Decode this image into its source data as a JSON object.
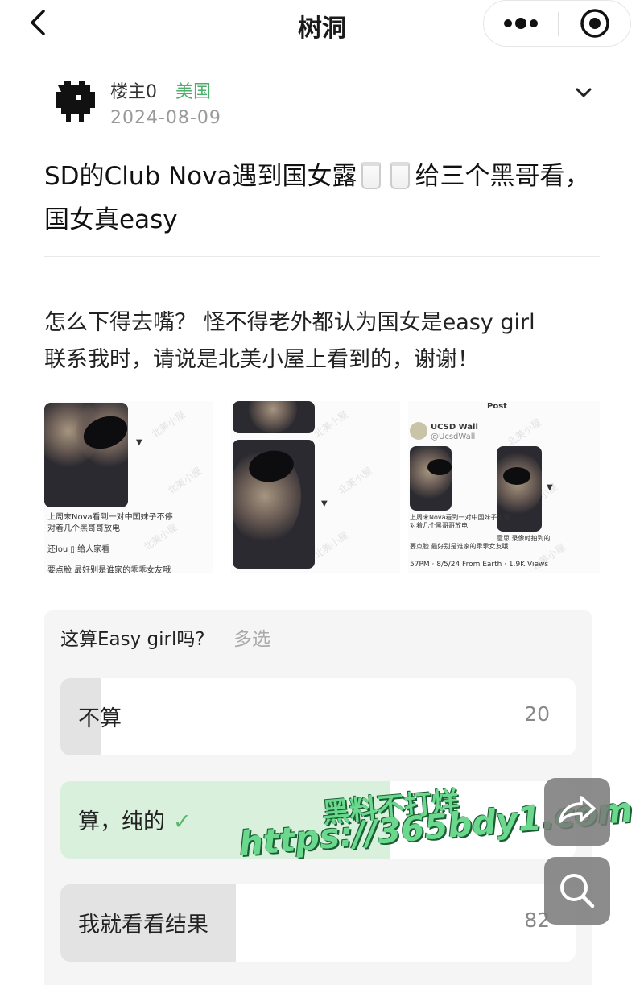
{
  "header": {
    "title": "树洞",
    "back_icon": "chevron-left-icon",
    "more_icon": "more-dots-icon",
    "target_icon": "record-target-icon"
  },
  "post": {
    "author": "楼主0",
    "location": "美国",
    "date": "2024-08-09",
    "title_part1": "SD的Club Nova遇到国女露",
    "title_part2": "给三个黑哥看， 国女真easy",
    "body_line1": "怎么下得去嘴？ 怪不得老外都认为国女是easy girl",
    "body_line2": "联系我时，请说是北美小屋上看到的，谢谢！"
  },
  "images": {
    "thumb1": {
      "caption1": "上周末Nova看到一对中国妹子不停",
      "caption2": "对着几个黑哥哥放电",
      "caption3": "还lou",
      "caption4": "给人家看",
      "caption5": "要点脸 最好别是谁家的乖乖女友哦"
    },
    "thumb3": {
      "heading": "Post",
      "account_name": "UCSD Wall",
      "account_handle": "@UcsdWall",
      "caption1": "上周末Nova看到一对中国妹子不停",
      "caption2": "对着几个黑哥哥放电",
      "caption3": "要点脸 最好别是谁家的乖乖女友哦",
      "footer": "57PM · 8/5/24 From Earth · 1.9K Views",
      "side_caption": "意思 录像时拍到的"
    },
    "watermark_text": "北美小屋"
  },
  "poll": {
    "question": "这算Easy girl吗?",
    "type": "多选",
    "options": [
      {
        "label": "不算",
        "count": "20",
        "fraction": 0.08,
        "selected": false
      },
      {
        "label": "算，纯的",
        "count": "",
        "fraction": 0.64,
        "selected": true,
        "check": "✓"
      },
      {
        "label": "我就看看结果",
        "count": "82",
        "fraction": 0.34,
        "selected": false
      }
    ]
  },
  "floating": {
    "share_icon": "share-arrow-icon",
    "search_icon": "search-icon"
  },
  "overlay_watermark": {
    "line1": "黑料不打烊",
    "line2": "https://365bdy1.com"
  },
  "colors": {
    "accent_green": "#4caf6a",
    "selected_bar": "#d9f0dc",
    "bar_gray": "#e3e3e3",
    "poll_bg": "#f5f5f5"
  }
}
